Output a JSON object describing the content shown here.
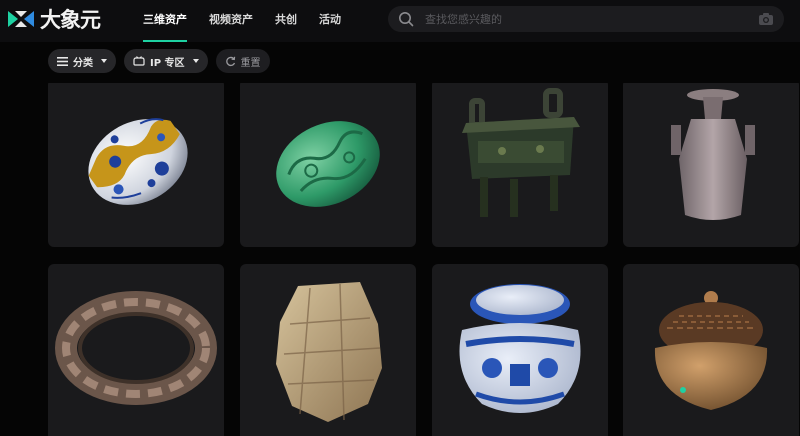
{
  "brand": {
    "name": "大象元"
  },
  "nav": {
    "items": [
      "三维资产",
      "视频资产",
      "共创",
      "活动"
    ],
    "active": 0
  },
  "search": {
    "placeholder": "查找您感兴趣的"
  },
  "filters": {
    "category": "分类",
    "ip_zone": "IP 专区",
    "reset": "重置"
  },
  "assets": [
    {
      "name": "blue-white-porcelain-egg"
    },
    {
      "name": "jade-carved-egg"
    },
    {
      "name": "bronze-ding-vessel"
    },
    {
      "name": "ceramic-vase"
    },
    {
      "name": "carved-stone-bangle"
    },
    {
      "name": "carved-stone-fragment"
    },
    {
      "name": "blue-white-porcelain-jar"
    },
    {
      "name": "incense-burner"
    }
  ],
  "colors": {
    "accent": "#1ed1a2",
    "background": "#050505",
    "card": "#1a1a1c"
  }
}
